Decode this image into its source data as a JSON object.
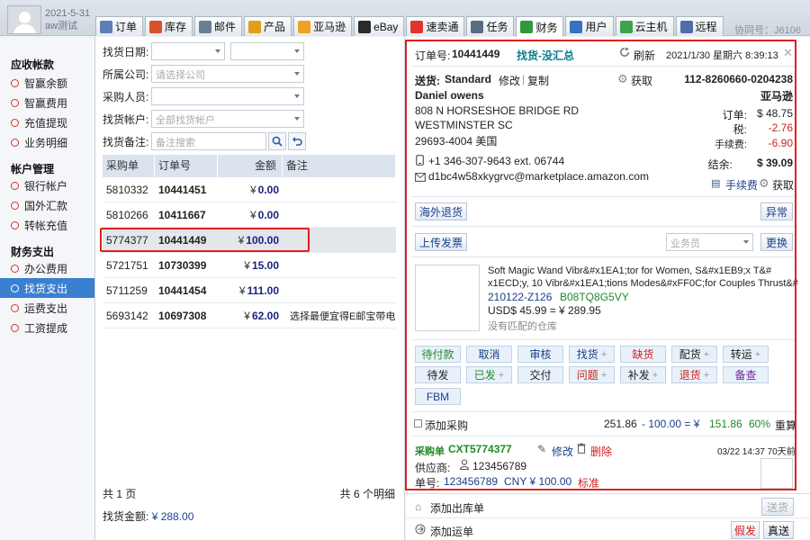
{
  "header": {
    "date": "2021-5-31",
    "username": "aw测试",
    "help_no": "协同号：J6106",
    "tabs": [
      {
        "label": "订单",
        "icon": "order-icon",
        "color": "#5b7fb6"
      },
      {
        "label": "库存",
        "icon": "stock-icon",
        "color": "#d9502c"
      },
      {
        "label": "邮件",
        "icon": "mail-icon",
        "color": "#6b7d93"
      },
      {
        "label": "产品",
        "icon": "product-icon",
        "color": "#e39d1b"
      },
      {
        "label": "亚马逊",
        "icon": "amazon-icon",
        "color": "#f0a12a"
      },
      {
        "label": "eBay",
        "icon": "ebay-icon",
        "color": "#2a2a2a"
      },
      {
        "label": "速卖通",
        "icon": "aliexpress-icon",
        "color": "#e0352c"
      },
      {
        "label": "任务",
        "icon": "task-icon",
        "color": "#5a6c82"
      },
      {
        "label": "财务",
        "icon": "finance-icon",
        "color": "#2d9a3d"
      },
      {
        "label": "用户",
        "icon": "user-icon",
        "color": "#3b6fc0"
      },
      {
        "label": "云主机",
        "icon": "cloud-host-icon",
        "color": "#3fa34d"
      },
      {
        "label": "远程",
        "icon": "remote-icon",
        "color": "#4c6fa8"
      }
    ]
  },
  "sidebar": {
    "groups": [
      {
        "title": "应收帐款",
        "items": [
          "智赢余额",
          "智赢费用",
          "充值提现",
          "业务明细"
        ]
      },
      {
        "title": "帐户管理",
        "items": [
          "银行帐户",
          "国外汇款",
          "转帐充值"
        ]
      },
      {
        "title": "财务支出",
        "items": [
          "办公费用",
          "找货支出",
          "运费支出",
          "工资提成"
        ]
      }
    ],
    "active": "找货支出"
  },
  "filters": {
    "date_label": "找货日期:",
    "company_label": "所属公司:",
    "company_placeholder": "请选择公司",
    "buyer_label": "采购人员:",
    "account_label": "找货帐户:",
    "account_placeholder": "全部找货帐户",
    "note_label": "找货备注:",
    "note_placeholder": "备注搜索"
  },
  "list": {
    "columns": [
      "采购单",
      "订单号",
      "金额",
      "备注"
    ],
    "currency": "¥",
    "rows": [
      {
        "po": "5810332",
        "order": "10441451",
        "amount": "0.00",
        "note": ""
      },
      {
        "po": "5810266",
        "order": "10411667",
        "amount": "0.00",
        "note": ""
      },
      {
        "po": "5774377",
        "order": "10441449",
        "amount": "100.00",
        "note": ""
      },
      {
        "po": "5721751",
        "order": "10730399",
        "amount": "15.00",
        "note": ""
      },
      {
        "po": "5711259",
        "order": "10441454",
        "amount": "111.00",
        "note": ""
      },
      {
        "po": "5693142",
        "order": "10697308",
        "amount": "62.00",
        "note": "选择最便宜得E邮宝带电"
      }
    ],
    "selected_index": 2,
    "pages": "共 1 页",
    "count": "共 6 个明细",
    "total_label": "找货金额:",
    "total_value": "¥ 288.00"
  },
  "detail": {
    "order_label": "订单号:",
    "order_no": "10441449",
    "status": "找货-没汇总",
    "refresh": "刷新",
    "datetime": "2021/1/30 星期六 8:39:13",
    "ship_label": "送货:",
    "ship_method": "Standard",
    "edit": "修改",
    "copy": "复制",
    "fetch": "获取",
    "name": "Daniel owens",
    "addr1": "808 N HORSESHOE BRIDGE RD",
    "addr2": "WESTMINSTER   SC",
    "addr3": "29693-4004  美国",
    "phone": "+1 346-307-9643 ext. 06744",
    "email": "d1bc4w58xkygrvc@marketplace.amazon.com",
    "platform_order": "112-8260660-0204238",
    "platform": "亚马逊",
    "fee_order_label": "订单:",
    "fee_order": "$ 48.75",
    "fee_tax_label": "税:",
    "fee_tax": "-2.76",
    "fee_handling_label": "手续费:",
    "fee_handling": "-6.90",
    "settle_label": "结余:",
    "settle": "$ 39.09",
    "handling_fee_link": "手续费",
    "fetch2": "获取",
    "return_btn": "海外退货",
    "abnormal_btn": "异常",
    "upload_invoice": "上传发票",
    "salesman_placeholder": "业务员",
    "switch_btn": "更换",
    "product_title_1": "Soft Magic Wand Vibr&#x1EA1;tor for Women, S&#x1EB9;x T&#",
    "product_title_2": "x1ECD;y, 10 Vibr&#x1EA1;tions Modes&#xFF0C;for Couples Thrust&#",
    "sku": "210122-Z126",
    "asin": "B08TQ8G5VY",
    "price": "USD$ 45.99 = ¥ 289.95",
    "no_warehouse": "没有匹配的仓库",
    "actions_row1": [
      {
        "label": "待付款",
        "color": "green",
        "plus": false
      },
      {
        "label": "取消",
        "color": "blue",
        "plus": false
      },
      {
        "label": "审核",
        "color": "blue",
        "plus": false
      },
      {
        "label": "找货",
        "color": "blue",
        "plus": true
      },
      {
        "label": "缺货",
        "color": "red",
        "plus": false
      },
      {
        "label": "配货",
        "color": "black",
        "plus": true
      },
      {
        "label": "转运",
        "color": "black",
        "plus": true
      }
    ],
    "actions_row2": [
      {
        "label": "待发",
        "color": "black",
        "plus": false
      },
      {
        "label": "已发",
        "color": "green",
        "plus": true
      },
      {
        "label": "交付",
        "color": "black",
        "plus": false
      },
      {
        "label": "问题",
        "color": "red",
        "plus": true
      },
      {
        "label": "补发",
        "color": "black",
        "plus": true
      },
      {
        "label": "退货",
        "color": "red",
        "plus": true
      },
      {
        "label": "备查",
        "color": "purple",
        "plus": false
      }
    ],
    "fbm_btn": "FBM",
    "add_purchase": "添加采购",
    "calc_a": "251.86",
    "calc_op": "- 100.00 = ¥",
    "calc_b": "151.86",
    "calc_pct": "60%",
    "recalc": "重算",
    "po_label": "采购单",
    "po_no": "CXT5774377",
    "po_edit": "修改",
    "po_delete": "删除",
    "po_time": "03/22 14:37 70天前",
    "supplier_label": "供应商:",
    "supplier": "123456789",
    "bill_label": "单号:",
    "bill_no": "123456789",
    "bill_amount": "CNY ¥ 100.00",
    "bill_tag": "标准",
    "add_outbound": "添加出库单",
    "deliver_btn": "送货",
    "add_shipment": "添加运单",
    "fake_btn": "假发",
    "real_btn": "真送"
  }
}
